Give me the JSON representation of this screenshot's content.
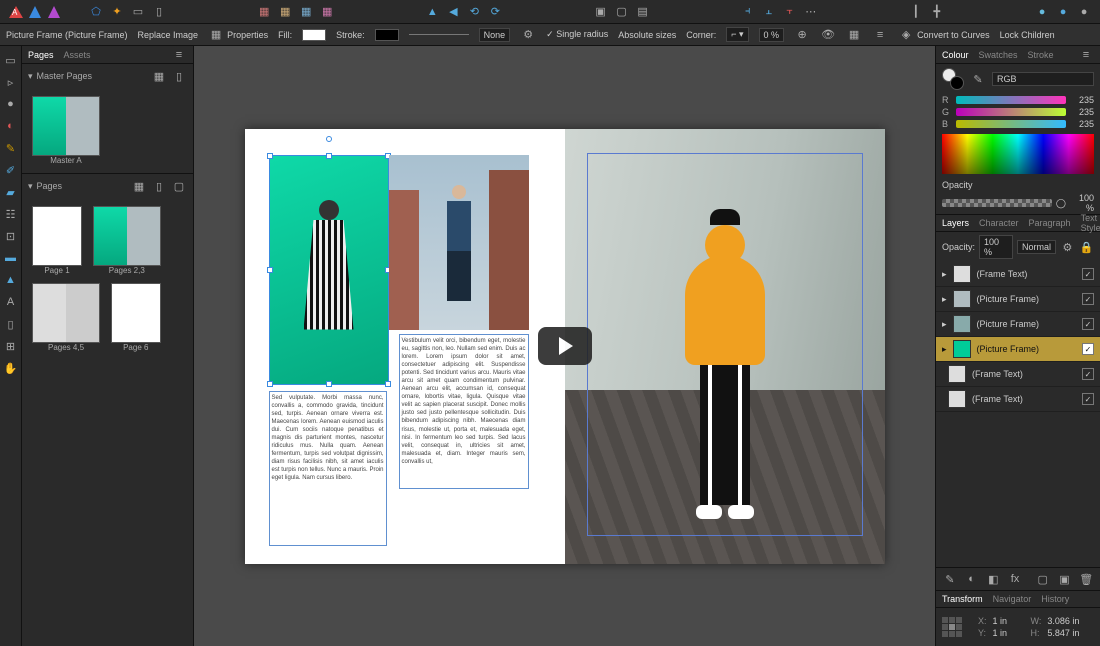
{
  "toolbar": {
    "doc_title": ""
  },
  "contextbar": {
    "object_label": "Picture Frame (Picture Frame)",
    "replace_image": "Replace Image",
    "properties": "Properties",
    "fill": "Fill:",
    "stroke": "Stroke:",
    "stroke_style": "None",
    "single_radius": "Single radius",
    "absolute_sizes": "Absolute sizes",
    "corner": "Corner:",
    "corner_val": "0 %",
    "convert": "Convert to Curves",
    "lock_children": "Lock Children"
  },
  "panels_left": {
    "tabs": {
      "pages": "Pages",
      "assets": "Assets"
    },
    "master_pages_hdr": "Master Pages",
    "master_a": "Master A",
    "pages_hdr": "Pages",
    "page1": "Page 1",
    "pages23": "Pages 2,3",
    "pages45": "Pages 4,5",
    "page6": "Page 6"
  },
  "canvas": {
    "text_left": "Sed vulputate. Morbi massa nunc, convallis a, commodo gravida, tincidunt sed, turpis. Aenean ornare viverra est. Maecenas lorem. Aenean euismod iaculis dui. Cum sociis natoque penatibus et magnis dis parturient montes, nascetur ridiculus mus. Nulla quam. Aenean fermentum, turpis sed volutpat dignissim, diam risus facilisis nibh, sit amet iaculis est turpis non tellus. Nunc a mauris. Proin eget ligula. Nam cursus libero.",
    "text_right": "Vestibulum velit orci, bibendum eget, molestie eu, sagittis non, leo. Nullam sed enim. Duis ac lorem. Lorem ipsum dolor sit amet, consectetuer adipiscing elit. Suspendisse potenti. Sed tincidunt varius arcu. Mauris vitae arcu sit amet quam condimentum pulvinar. Aenean arcu elit, accumsan id, consequat ornare, lobortis vitae, ligula. Quisque vitae velit ac sapien placerat suscipit. Donec mollis justo sed justo pellentesque sollicitudin. Duis bibendum adipiscing nibh. Maecenas diam risus, molestie ut, porta et, malesuada eget, nisi. In fermentum leo sed turpis. Sed lacus velit, consequat in, ultricies sit amet, malesuada et, diam. Integer mauris sem, convallis ut,"
  },
  "color_panel": {
    "tabs": {
      "colour": "Colour",
      "swatches": "Swatches",
      "stroke": "Stroke"
    },
    "mode": "RGB",
    "r": "R",
    "g": "G",
    "b": "B",
    "r_val": "235",
    "g_val": "235",
    "b_val": "235",
    "opacity_label": "Opacity",
    "opacity_val": "100 %"
  },
  "layers_panel": {
    "tabs": {
      "layers": "Layers",
      "character": "Character",
      "paragraph": "Paragraph",
      "text_styles": "Text Styles"
    },
    "opacity_label": "Opacity:",
    "opacity_val": "100 %",
    "blend": "Normal",
    "items": [
      {
        "name": "(Frame Text)"
      },
      {
        "name": "(Picture Frame)"
      },
      {
        "name": "(Picture Frame)"
      },
      {
        "name": "(Picture Frame)"
      },
      {
        "name": "(Frame Text)"
      },
      {
        "name": "(Frame Text)"
      }
    ]
  },
  "transform_panel": {
    "tabs": {
      "transform": "Transform",
      "navigator": "Navigator",
      "history": "History"
    },
    "x_lbl": "X:",
    "x_val": "1 in",
    "y_lbl": "Y:",
    "y_val": "1 in",
    "w_lbl": "W:",
    "w_val": "3.086 in",
    "h_lbl": "H:",
    "h_val": "5.847 in"
  }
}
